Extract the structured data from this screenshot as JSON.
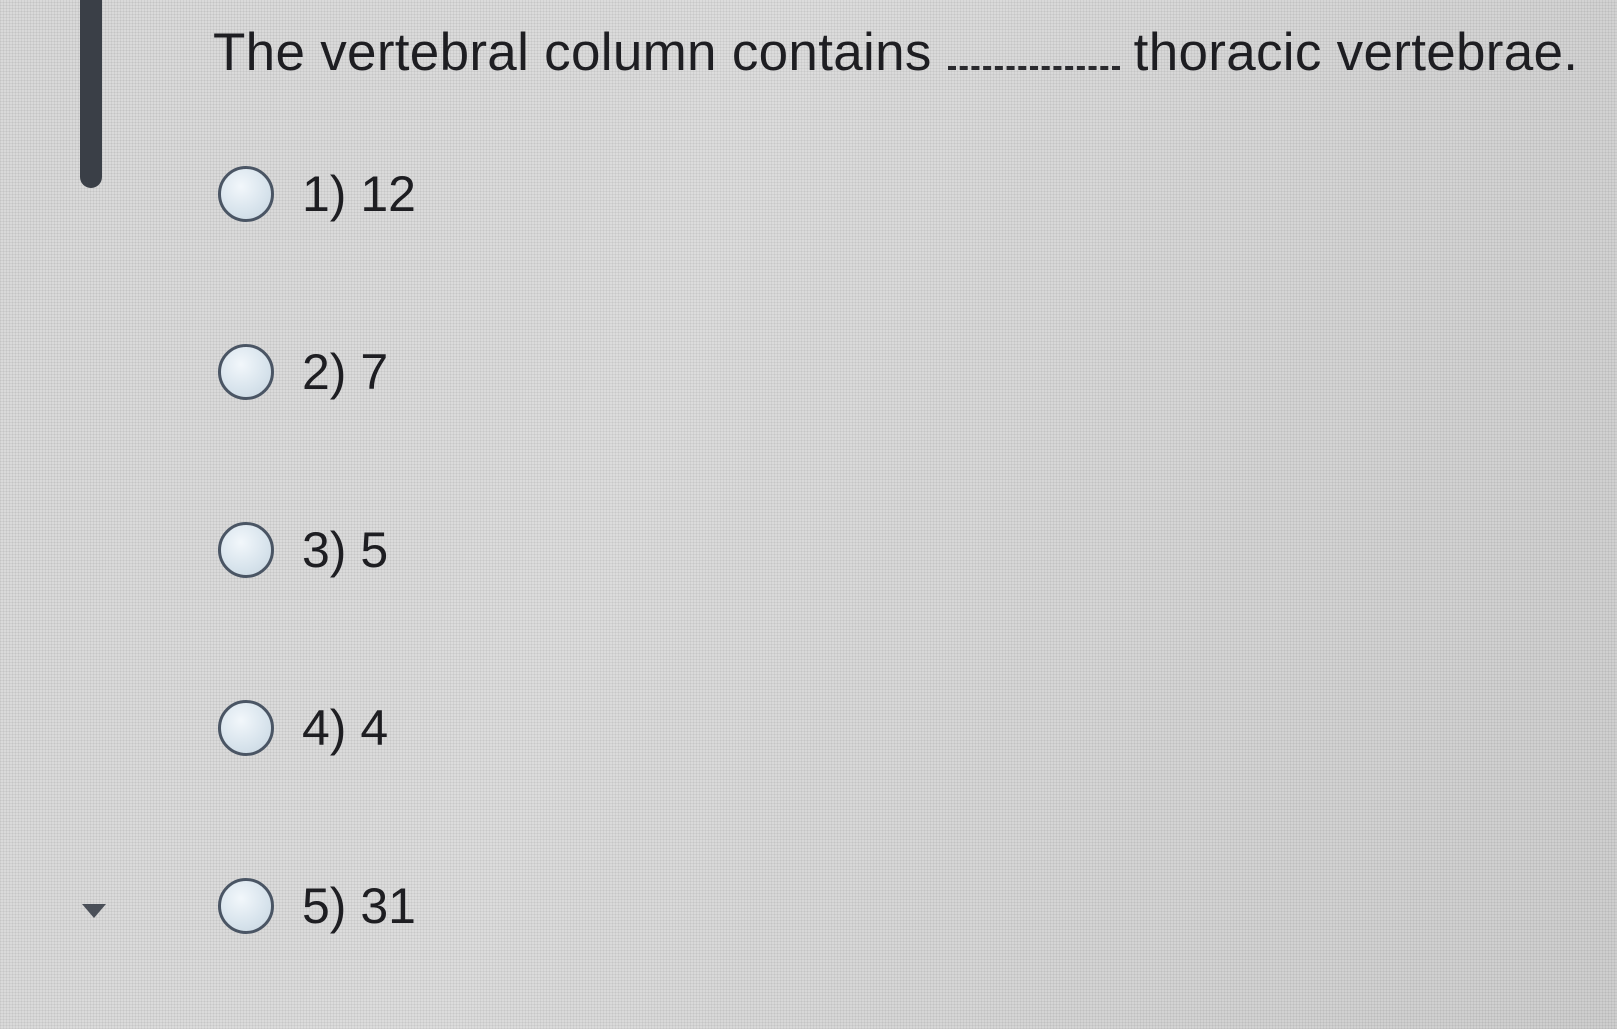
{
  "question": {
    "text_before": "The vertebral column contains",
    "text_after": "thoracic vertebrae."
  },
  "options": [
    {
      "label": "1) 12"
    },
    {
      "label": "2) 7"
    },
    {
      "label": "3) 5"
    },
    {
      "label": "4) 4"
    },
    {
      "label": "5) 31"
    }
  ],
  "icons": {
    "question_bar": "active-question-indicator",
    "collapse": "triangle-down-icon"
  },
  "colors": {
    "text": "#1e1e22",
    "indicator": "#3a3f47",
    "radio_border": "#4a5564"
  }
}
